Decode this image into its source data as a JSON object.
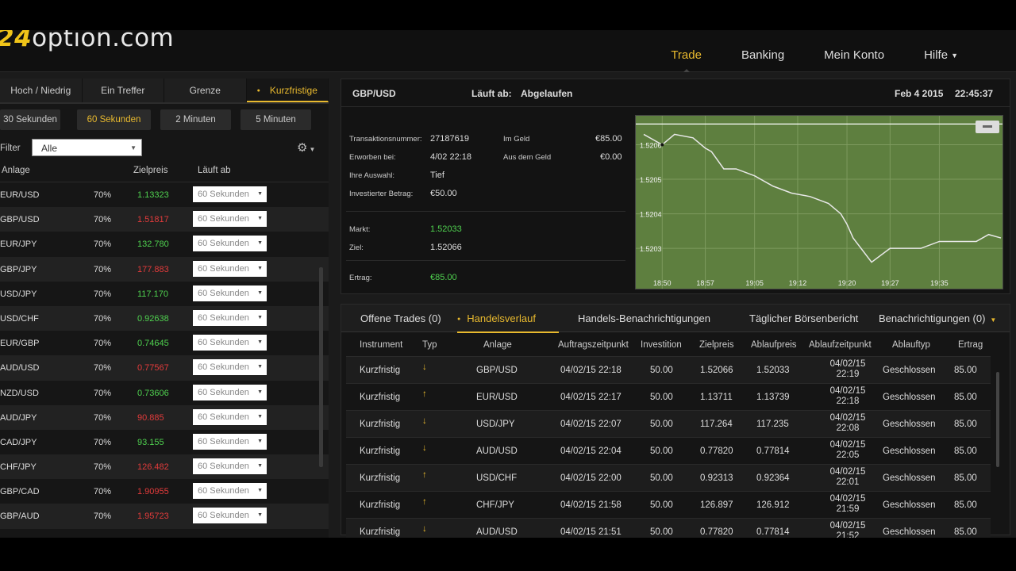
{
  "app": {
    "logo_prefix": "24",
    "logo_suffix": "option.com"
  },
  "nav": {
    "items": [
      "Trade",
      "Banking",
      "Mein Konto",
      "Hilfe"
    ]
  },
  "left": {
    "tabs": [
      "Hoch / Niedrig",
      "Ein Treffer",
      "Grenze",
      "Kurzfristige"
    ],
    "durations": [
      "30 Sekunden",
      "60 Sekunden",
      "2 Minuten",
      "5 Minuten"
    ],
    "filter_label": "Filter",
    "filter_value": "Alle",
    "col_asset": "Anlage",
    "col_target": "Zielpreis",
    "col_expiry": "Läuft ab",
    "assets": [
      {
        "sym": "EUR/USD",
        "pct": "70%",
        "price": "1.13323",
        "dir": "up",
        "exp": "60 Sekunden"
      },
      {
        "sym": "GBP/USD",
        "pct": "70%",
        "price": "1.51817",
        "dir": "dn",
        "exp": "60 Sekunden"
      },
      {
        "sym": "EUR/JPY",
        "pct": "70%",
        "price": "132.780",
        "dir": "up",
        "exp": "60 Sekunden"
      },
      {
        "sym": "GBP/JPY",
        "pct": "70%",
        "price": "177.883",
        "dir": "dn",
        "exp": "60 Sekunden"
      },
      {
        "sym": "USD/JPY",
        "pct": "70%",
        "price": "117.170",
        "dir": "up",
        "exp": "60 Sekunden"
      },
      {
        "sym": "USD/CHF",
        "pct": "70%",
        "price": "0.92638",
        "dir": "up",
        "exp": "60 Sekunden"
      },
      {
        "sym": "EUR/GBP",
        "pct": "70%",
        "price": "0.74645",
        "dir": "up",
        "exp": "60 Sekunden"
      },
      {
        "sym": "AUD/USD",
        "pct": "70%",
        "price": "0.77567",
        "dir": "dn",
        "exp": "60 Sekunden"
      },
      {
        "sym": "NZD/USD",
        "pct": "70%",
        "price": "0.73606",
        "dir": "up",
        "exp": "60 Sekunden"
      },
      {
        "sym": "AUD/JPY",
        "pct": "70%",
        "price": "90.885",
        "dir": "dn",
        "exp": "60 Sekunden"
      },
      {
        "sym": "CAD/JPY",
        "pct": "70%",
        "price": "93.155",
        "dir": "up",
        "exp": "60 Sekunden"
      },
      {
        "sym": "CHF/JPY",
        "pct": "70%",
        "price": "126.482",
        "dir": "dn",
        "exp": "60 Sekunden"
      },
      {
        "sym": "GBP/CAD",
        "pct": "70%",
        "price": "1.90955",
        "dir": "dn",
        "exp": "60 Sekunden"
      },
      {
        "sym": "GBP/AUD",
        "pct": "70%",
        "price": "1.95723",
        "dir": "dn",
        "exp": "60 Sekunden"
      }
    ]
  },
  "chart_panel": {
    "pair": "GBP/USD",
    "expires_label": "Läuft ab:",
    "expires_value": "Abgelaufen",
    "date": "Feb 4 2015",
    "time": "22:45:37",
    "info": {
      "tx_label": "Transaktionsnummer:",
      "tx_value": "27187619",
      "bought_label": "Erworben bei:",
      "bought_value": "4/02 22:18",
      "choice_label": "Ihre Auswahl:",
      "choice_value": "Tief",
      "invest_label": "Investierter Betrag:",
      "invest_value": "€50.00",
      "itm_label": "Im Geld",
      "itm_value": "€85.00",
      "otm_label": "Aus dem Geld",
      "otm_value": "€0.00",
      "market_label": "Markt:",
      "market_value": "1.52033",
      "target_label": "Ziel:",
      "target_value": "1.52066",
      "yield_label": "Ertrag:",
      "yield_value": "€85.00"
    }
  },
  "chart_data": {
    "type": "line",
    "x": [
      "18:47",
      "18:50",
      "18:52",
      "18:55",
      "18:57",
      "18:58",
      "19:00",
      "19:02",
      "19:05",
      "19:08",
      "19:11",
      "19:14",
      "19:17",
      "19:19",
      "19:20",
      "19:21",
      "19:24",
      "19:27",
      "19:29",
      "19:32",
      "19:35",
      "19:38",
      "19:41",
      "19:43",
      "19:45"
    ],
    "values": [
      1.52063,
      1.5206,
      1.52063,
      1.52062,
      1.52059,
      1.52058,
      1.52053,
      1.52053,
      1.52051,
      1.52048,
      1.52046,
      1.52045,
      1.52043,
      1.5204,
      1.52037,
      1.52033,
      1.52026,
      1.5203,
      1.5203,
      1.5203,
      1.52032,
      1.52032,
      1.52032,
      1.52034,
      1.52033
    ],
    "target": 1.52066,
    "ylim": [
      1.52022,
      1.52067
    ],
    "yticks": [
      "1.5206",
      "1.5205",
      "1.5204",
      "1.5203"
    ],
    "xticks": [
      "18:50",
      "18:57",
      "19:05",
      "19:12",
      "19:20",
      "19:27",
      "19:35"
    ],
    "grid": true,
    "line_color": "#e8e8e8",
    "bg_color": "#5e7f3f"
  },
  "history": {
    "tabs": [
      "Offene Trades (0)",
      "Handelsverlauf",
      "Handels-Benachrichtigungen",
      "Täglicher Börsenbericht",
      "Benachrichtigungen (0)"
    ],
    "cols": [
      "Instrument",
      "Typ",
      "Anlage",
      "Auftragszeitpunkt",
      "Investition",
      "Zielpreis",
      "Ablaufpreis",
      "Ablaufzeitpunkt",
      "Ablauftyp",
      "Ertrag"
    ],
    "rows": [
      {
        "inst": "Kurzfristig",
        "dir": "down",
        "asset": "GBP/USD",
        "time": "04/02/15 22:18",
        "inv": "50.00",
        "target": "1.52066",
        "exp_price": "1.52033",
        "exp_date": "04/02/15",
        "exp_time": "22:19",
        "type": "Geschlossen",
        "yield": "85.00"
      },
      {
        "inst": "Kurzfristig",
        "dir": "up",
        "asset": "EUR/USD",
        "time": "04/02/15 22:17",
        "inv": "50.00",
        "target": "1.13711",
        "exp_price": "1.13739",
        "exp_date": "04/02/15",
        "exp_time": "22:18",
        "type": "Geschlossen",
        "yield": "85.00"
      },
      {
        "inst": "Kurzfristig",
        "dir": "down",
        "asset": "USD/JPY",
        "time": "04/02/15 22:07",
        "inv": "50.00",
        "target": "117.264",
        "exp_price": "117.235",
        "exp_date": "04/02/15",
        "exp_time": "22:08",
        "type": "Geschlossen",
        "yield": "85.00"
      },
      {
        "inst": "Kurzfristig",
        "dir": "down",
        "asset": "AUD/USD",
        "time": "04/02/15 22:04",
        "inv": "50.00",
        "target": "0.77820",
        "exp_price": "0.77814",
        "exp_date": "04/02/15",
        "exp_time": "22:05",
        "type": "Geschlossen",
        "yield": "85.00"
      },
      {
        "inst": "Kurzfristig",
        "dir": "up",
        "asset": "USD/CHF",
        "time": "04/02/15 22:00",
        "inv": "50.00",
        "target": "0.92313",
        "exp_price": "0.92364",
        "exp_date": "04/02/15",
        "exp_time": "22:01",
        "type": "Geschlossen",
        "yield": "85.00"
      },
      {
        "inst": "Kurzfristig",
        "dir": "up",
        "asset": "CHF/JPY",
        "time": "04/02/15 21:58",
        "inv": "50.00",
        "target": "126.897",
        "exp_price": "126.912",
        "exp_date": "04/02/15",
        "exp_time": "21:59",
        "type": "Geschlossen",
        "yield": "85.00"
      },
      {
        "inst": "Kurzfristig",
        "dir": "down",
        "asset": "AUD/USD",
        "time": "04/02/15 21:51",
        "inv": "50.00",
        "target": "0.77820",
        "exp_price": "0.77814",
        "exp_date": "04/02/15",
        "exp_time": "21:52",
        "type": "Geschlossen",
        "yield": "85.00"
      }
    ]
  }
}
